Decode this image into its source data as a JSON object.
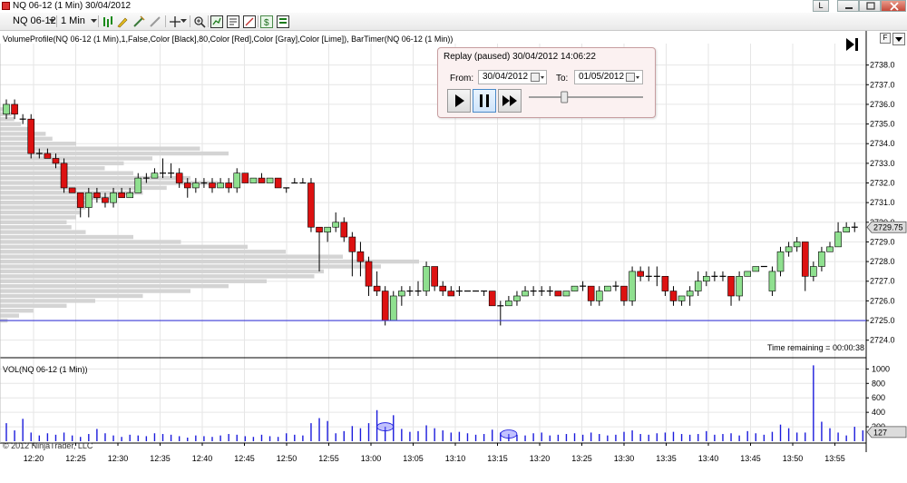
{
  "window": {
    "title": "NQ 06-12 (1 Min)  30/04/2012",
    "buttons": [
      "L",
      "",
      "",
      ""
    ]
  },
  "toolbar": {
    "instrument": "NQ 06-12",
    "interval": "1 Min"
  },
  "indicator_label": "VolumeProfile(NQ 06-12 (1 Min),1,False,Color [Black],80,Color [Red],Color [Gray],Color [Lime]), BarTimer(NQ 06-12 (1 Min))",
  "replay": {
    "title": "Replay (paused) 30/04/2012 14:06:22",
    "from_label": "From:",
    "from_value": "30/04/2012",
    "to_label": "To:",
    "to_value": "01/05/2012",
    "speed": 0.3
  },
  "time_remaining": "Time remaining = 00:00:38",
  "volume_label": "VOL(NQ 06-12 (1 Min))",
  "copyright": "© 2012 NinjaTrader, LLC",
  "colors": {
    "up": "#8fe08f",
    "down": "#dd1111",
    "volume": "#1a1adc",
    "price_line": "#3b3bd6",
    "profile": "#d4d4d4",
    "grid": "#e6e6e6"
  },
  "chart_data": [
    {
      "type": "candlestick",
      "price_axis": {
        "ticks": [
          2724,
          2725,
          2726,
          2727,
          2728,
          2729,
          2730,
          2731,
          2732,
          2733,
          2734,
          2735,
          2736,
          2737,
          2738
        ],
        "range": [
          2723.2,
          2739
        ]
      },
      "time_axis": {
        "ticks": [
          "12:20",
          "12:25",
          "12:30",
          "12:35",
          "12:40",
          "12:45",
          "12:50",
          "12:55",
          "13:00",
          "13:05",
          "13:10",
          "13:15",
          "13:20",
          "13:25",
          "13:30",
          "13:35",
          "13:40",
          "13:45",
          "13:50",
          "13:55"
        ]
      },
      "last_price": 2729.75,
      "last_price_label": "2729.75",
      "horizontal_line": 2725,
      "bars": [
        [
          2735.5,
          2736.25,
          2735.25,
          2736
        ],
        [
          2736,
          2736.25,
          2735.25,
          2735.5
        ],
        [
          2735.25,
          2735.5,
          2735,
          2735.25
        ],
        [
          2735.25,
          2735.5,
          2733.25,
          2733.5
        ],
        [
          2733.5,
          2733.75,
          2733.25,
          2733.5
        ],
        [
          2733.5,
          2733.75,
          2733.25,
          2733.25
        ],
        [
          2733.25,
          2733.5,
          2732.75,
          2733
        ],
        [
          2733,
          2733.25,
          2731.5,
          2731.75
        ],
        [
          2731.75,
          2731.75,
          2731.5,
          2731.5
        ],
        [
          2731.5,
          2731.5,
          2730.25,
          2730.75
        ],
        [
          2730.75,
          2731.75,
          2730.25,
          2731.5
        ],
        [
          2731.5,
          2731.75,
          2731,
          2731.25
        ],
        [
          2731.25,
          2731.5,
          2730.75,
          2731
        ],
        [
          2731,
          2731.75,
          2730.75,
          2731.5
        ],
        [
          2731.5,
          2731.75,
          2731.25,
          2731.25
        ],
        [
          2731.25,
          2731.75,
          2731.25,
          2731.5
        ],
        [
          2731.5,
          2732.5,
          2731.5,
          2732.25
        ],
        [
          2732.25,
          2732.5,
          2732,
          2732.25
        ],
        [
          2732.25,
          2732.75,
          2732.25,
          2732.5
        ],
        [
          2732.5,
          2733.25,
          2732.25,
          2732.5
        ],
        [
          2732.5,
          2733,
          2732.25,
          2732.5
        ],
        [
          2732.5,
          2732.75,
          2731.75,
          2732
        ],
        [
          2732,
          2732.25,
          2731.25,
          2731.75
        ],
        [
          2731.75,
          2732.25,
          2731.5,
          2732
        ],
        [
          2732,
          2732.25,
          2731.75,
          2732
        ],
        [
          2732,
          2732.25,
          2731.5,
          2731.75
        ],
        [
          2731.75,
          2732.25,
          2731.75,
          2732
        ],
        [
          2732,
          2732.25,
          2731.5,
          2731.75
        ],
        [
          2731.75,
          2732.75,
          2731.5,
          2732.5
        ],
        [
          2732.5,
          2732.5,
          2732,
          2732
        ],
        [
          2732,
          2732.25,
          2732,
          2732.25
        ],
        [
          2732.25,
          2732.5,
          2732,
          2732
        ],
        [
          2732,
          2732.25,
          2732,
          2732.25
        ],
        [
          2732.25,
          2732.25,
          2731.75,
          2731.75
        ],
        [
          2731.75,
          2731.75,
          2731.5,
          2731.75
        ],
        [
          2732,
          2732.25,
          2732,
          2732
        ],
        [
          2732,
          2732.25,
          2732,
          2732
        ],
        [
          2732,
          2732.25,
          2729.5,
          2729.75
        ],
        [
          2729.75,
          2729.75,
          2727.5,
          2729.5
        ],
        [
          2729.5,
          2729.75,
          2729,
          2729.75
        ],
        [
          2729.75,
          2730.5,
          2729.5,
          2730
        ],
        [
          2730,
          2730.25,
          2729,
          2729.25
        ],
        [
          2729.25,
          2729.5,
          2727.25,
          2728.5
        ],
        [
          2728.5,
          2729,
          2727.25,
          2728
        ],
        [
          2728,
          2728.25,
          2726.25,
          2726.75
        ],
        [
          2726.75,
          2727.5,
          2726.25,
          2726.5
        ],
        [
          2726.5,
          2726.75,
          2724.75,
          2725
        ],
        [
          2725,
          2726.5,
          2725,
          2726.25
        ],
        [
          2726.25,
          2726.75,
          2725.75,
          2726.5
        ],
        [
          2726.5,
          2726.75,
          2726.25,
          2726.5
        ],
        [
          2726.5,
          2727,
          2726.25,
          2726.5
        ],
        [
          2726.5,
          2728,
          2726.25,
          2727.75
        ],
        [
          2727.75,
          2727.75,
          2726.5,
          2726.75
        ],
        [
          2726.75,
          2727,
          2726.25,
          2726.5
        ],
        [
          2726.5,
          2726.75,
          2726.25,
          2726.25
        ],
        [
          2726.5,
          2726.75,
          2726.25,
          2726.5
        ],
        [
          2726.5,
          2726.5,
          2726.5,
          2726.5
        ],
        [
          2726.5,
          2726.5,
          2726.5,
          2726.5
        ],
        [
          2726.5,
          2726.5,
          2726.25,
          2726.5
        ],
        [
          2726.5,
          2726.5,
          2726,
          2725.75
        ],
        [
          2725.75,
          2726,
          2724.75,
          2725.75
        ],
        [
          2725.75,
          2726.25,
          2725.75,
          2726
        ],
        [
          2726,
          2726.5,
          2725.75,
          2726.25
        ],
        [
          2726.25,
          2726.75,
          2726.25,
          2726.5
        ],
        [
          2726.5,
          2726.75,
          2726.25,
          2726.5
        ],
        [
          2726.5,
          2726.75,
          2726.25,
          2726.5
        ],
        [
          2726.5,
          2726.75,
          2726.25,
          2726.5
        ],
        [
          2726.5,
          2726.5,
          2726.25,
          2726.25
        ],
        [
          2726.25,
          2726.5,
          2726.25,
          2726.5
        ],
        [
          2726.5,
          2726.75,
          2726.5,
          2726.75
        ],
        [
          2726.75,
          2727,
          2726.5,
          2726.75
        ],
        [
          2726.75,
          2726.75,
          2725.75,
          2726
        ],
        [
          2726,
          2726.75,
          2725.75,
          2726.5
        ],
        [
          2726.5,
          2726.75,
          2726.5,
          2726.75
        ],
        [
          2726.75,
          2727,
          2726.5,
          2726.75
        ],
        [
          2726.75,
          2726.75,
          2725.75,
          2726
        ],
        [
          2726,
          2727.75,
          2725.75,
          2727.5
        ],
        [
          2727.5,
          2727.75,
          2727,
          2727.25
        ],
        [
          2727.25,
          2727.75,
          2727,
          2727.25
        ],
        [
          2727.25,
          2727.75,
          2726.75,
          2727.25
        ],
        [
          2727.25,
          2727.25,
          2726.25,
          2726.5
        ],
        [
          2726.5,
          2726.75,
          2725.75,
          2726
        ],
        [
          2726,
          2726.25,
          2725.75,
          2726.25
        ],
        [
          2726.25,
          2726.75,
          2725.75,
          2726.5
        ],
        [
          2726.5,
          2727.5,
          2726.25,
          2727
        ],
        [
          2727,
          2727.5,
          2726.75,
          2727.25
        ],
        [
          2727.25,
          2727.5,
          2727,
          2727.25
        ],
        [
          2727.25,
          2727.5,
          2727,
          2727.25
        ],
        [
          2727.25,
          2727.25,
          2725.75,
          2726.25
        ],
        [
          2726.25,
          2727.5,
          2726,
          2727.25
        ],
        [
          2727.25,
          2727.5,
          2727.25,
          2727.5
        ],
        [
          2727.5,
          2727.75,
          2727.5,
          2727.75
        ],
        [
          2727.75,
          2727.75,
          2727.75,
          2727.75
        ],
        [
          2726.5,
          2727.75,
          2726.25,
          2727.5
        ],
        [
          2727.5,
          2728.75,
          2727.25,
          2728.5
        ],
        [
          2728.5,
          2729,
          2728.25,
          2728.75
        ],
        [
          2728.75,
          2729.25,
          2728.5,
          2729
        ],
        [
          2729,
          2729,
          2726.5,
          2727.25
        ],
        [
          2727.25,
          2728,
          2727,
          2727.75
        ],
        [
          2727.75,
          2728.75,
          2727.5,
          2728.5
        ],
        [
          2728.5,
          2729,
          2728.5,
          2728.75
        ],
        [
          2728.75,
          2730,
          2728.75,
          2729.5
        ],
        [
          2729.5,
          2730,
          2729.5,
          2729.75
        ],
        [
          2729.75,
          2730,
          2729.5,
          2729.75
        ]
      ],
      "profile_prices": [
        2735.75,
        2735.5,
        2735.25,
        2735,
        2734.75,
        2734.5,
        2734.25,
        2734,
        2733.75,
        2733.5,
        2733.25,
        2733,
        2732.75,
        2732.5,
        2732.25,
        2732,
        2731.75,
        2731.5,
        2731.25,
        2731,
        2730.75,
        2730.5,
        2730.25,
        2730,
        2729.75,
        2729.5,
        2729.25,
        2729,
        2728.75,
        2728.5,
        2728.25,
        2728,
        2727.75,
        2727.5,
        2727.25,
        2727,
        2726.75,
        2726.5,
        2726.25,
        2726,
        2725.75,
        2725.5,
        2725.25,
        2725
      ],
      "profile_volumes": [
        8,
        12,
        15,
        22,
        30,
        48,
        55,
        80,
        210,
        240,
        160,
        130,
        110,
        140,
        200,
        230,
        175,
        150,
        120,
        95,
        90,
        85,
        80,
        70,
        75,
        90,
        140,
        190,
        260,
        300,
        360,
        440,
        400,
        340,
        330,
        280,
        240,
        200,
        150,
        100,
        70,
        35,
        20,
        8
      ]
    },
    {
      "type": "bar",
      "title": "VOL(NQ 06-12 (1 Min))",
      "y_axis": {
        "ticks": [
          200,
          400,
          600,
          800,
          1000
        ],
        "range": [
          0,
          1080
        ]
      },
      "last_value": 127,
      "last_value_label": "127",
      "values": [
        250,
        150,
        310,
        120,
        80,
        110,
        90,
        120,
        80,
        60,
        100,
        170,
        110,
        80,
        60,
        90,
        80,
        70,
        110,
        100,
        90,
        70,
        50,
        80,
        70,
        60,
        80,
        100,
        90,
        70,
        60,
        90,
        70,
        60,
        110,
        90,
        80,
        250,
        320,
        280,
        110,
        140,
        210,
        180,
        250,
        430,
        200,
        360,
        170,
        130,
        140,
        220,
        180,
        150,
        120,
        130,
        110,
        90,
        100,
        160,
        120,
        100,
        90,
        80,
        110,
        120,
        80,
        90,
        100,
        110,
        90,
        120,
        100,
        80,
        90,
        130,
        150,
        100,
        90,
        110,
        120,
        130,
        100,
        90,
        100,
        140,
        90,
        100,
        110,
        80,
        140,
        110,
        90,
        130,
        230,
        180,
        120,
        120,
        1050,
        270,
        180,
        120,
        80,
        200,
        150
      ],
      "highlights": [
        46,
        61
      ]
    }
  ]
}
